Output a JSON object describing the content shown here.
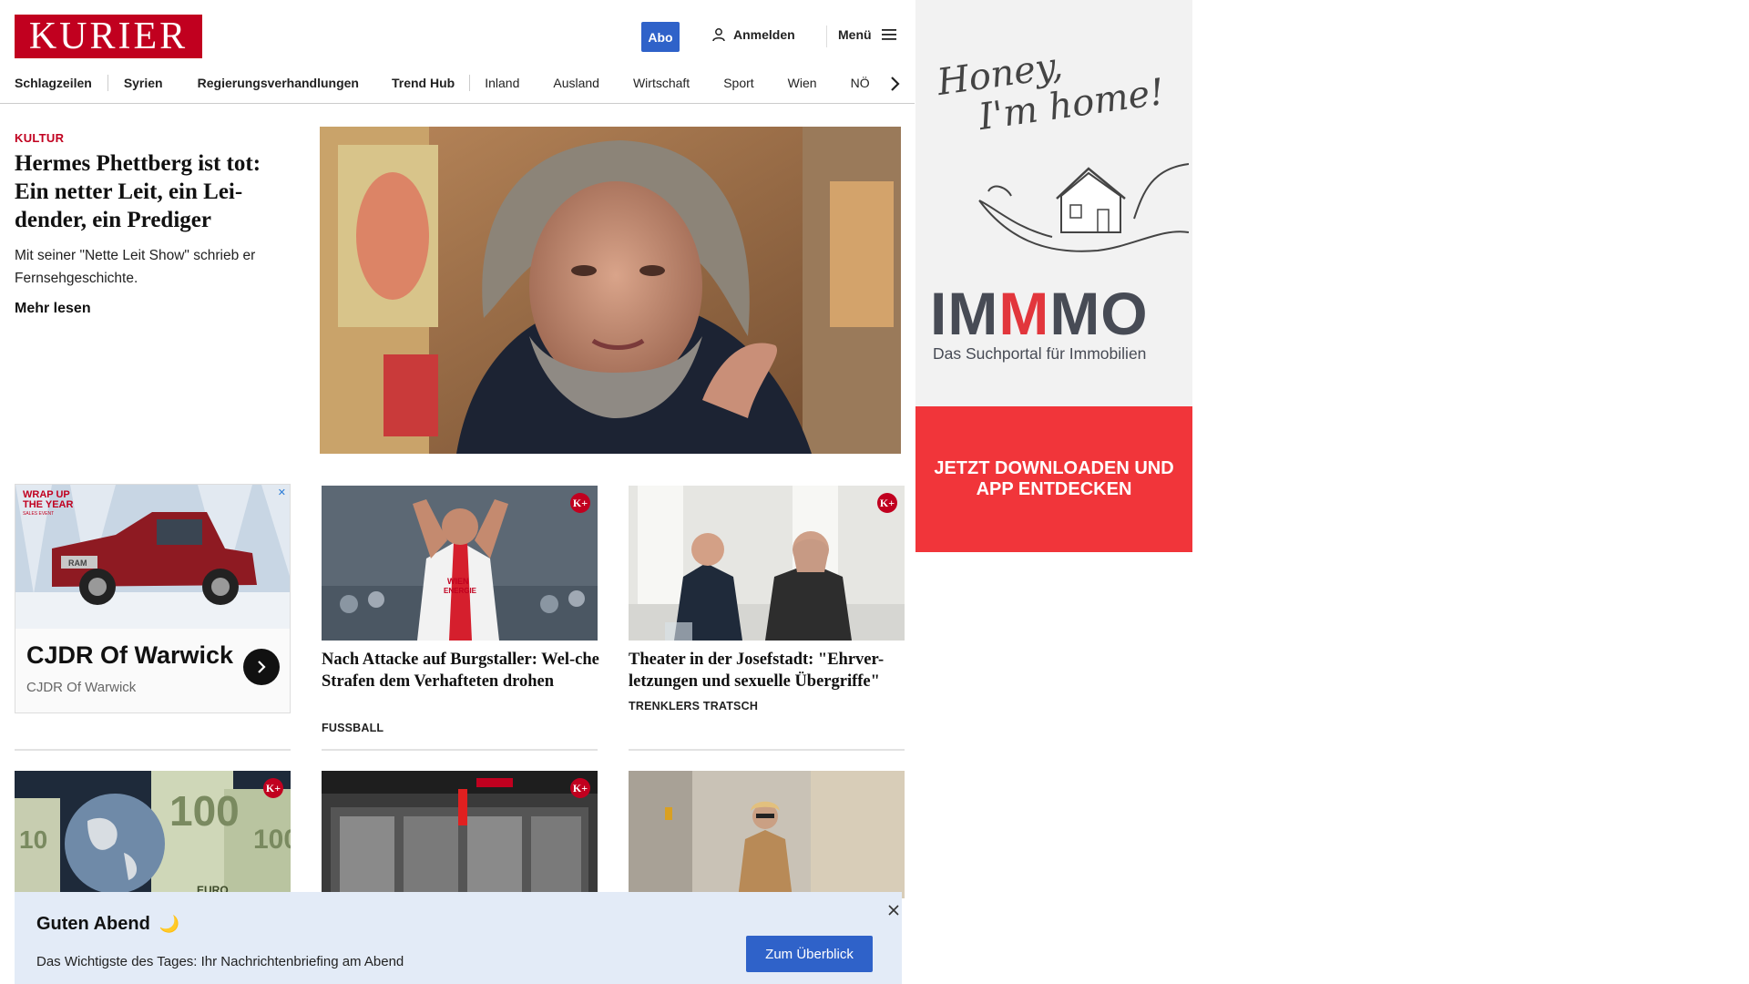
{
  "header": {
    "logo_text": "KURIER",
    "abo_label": "Abo",
    "login_label": "Anmelden",
    "menu_label": "Menü"
  },
  "nav": {
    "items": [
      {
        "label": "Schlagzeilen"
      },
      {
        "label": "Syrien"
      },
      {
        "label": "Regierungsverhandlungen"
      },
      {
        "label": "Trend Hub"
      },
      {
        "label": "Inland"
      },
      {
        "label": "Ausland"
      },
      {
        "label": "Wirtschaft"
      },
      {
        "label": "Sport"
      },
      {
        "label": "Wien"
      },
      {
        "label": "NÖ"
      }
    ]
  },
  "lead": {
    "kicker": "KULTUR",
    "title": "Hermes Phettberg ist tot: Ein netter Leit, ein Lei-dender, ein Prediger",
    "teaser": "Mit seiner \"Nette Leit Show\" schrieb er Fernsehgeschichte.",
    "more": "Mehr lesen"
  },
  "ad_card": {
    "headline": "CJDR Of Warwick",
    "sub": "CJDR Of Warwick",
    "badge_text_1": "WRAP UP",
    "badge_text_2": "THE YEAR",
    "badge_text_3": "SALES EVENT",
    "grille_text": "RAM"
  },
  "cards": [
    {
      "title": "Nach Attacke auf Burgstaller: Wel-che Strafen dem Verhafteten drohen",
      "kicker": "FUSSBALL",
      "badge": "K+",
      "shirt_text_1": "WIEN",
      "shirt_text_2": "ENERGIE"
    },
    {
      "title": "Theater in der Josefstadt: \"Ehrver-letzungen und sexuelle Übergriffe\"",
      "kicker": "TRENKLERS TRATSCH",
      "badge": "K+"
    }
  ],
  "cards_row2": [
    {
      "badge": "K+",
      "note_text_1": "100",
      "note_text_2": "100",
      "note_text_3": "10",
      "note_text_4": "EURO"
    },
    {
      "badge": "K+"
    },
    {}
  ],
  "side_ad": {
    "script_line1": "Honey,",
    "script_line2": "I'm home!",
    "brand_left": "IM",
    "brand_mid": "M",
    "brand_right": "MO",
    "tagline": "Das Suchportal für Immobilien",
    "cta": "JETZT DOWNLOADEN UND APP ENTDECKEN"
  },
  "banner": {
    "title": "Guten Abend",
    "moon": "🌙",
    "text": "Das Wichtigste des Tages: Ihr Nachrichtenbriefing am Abend",
    "button": "Zum Überblick"
  }
}
